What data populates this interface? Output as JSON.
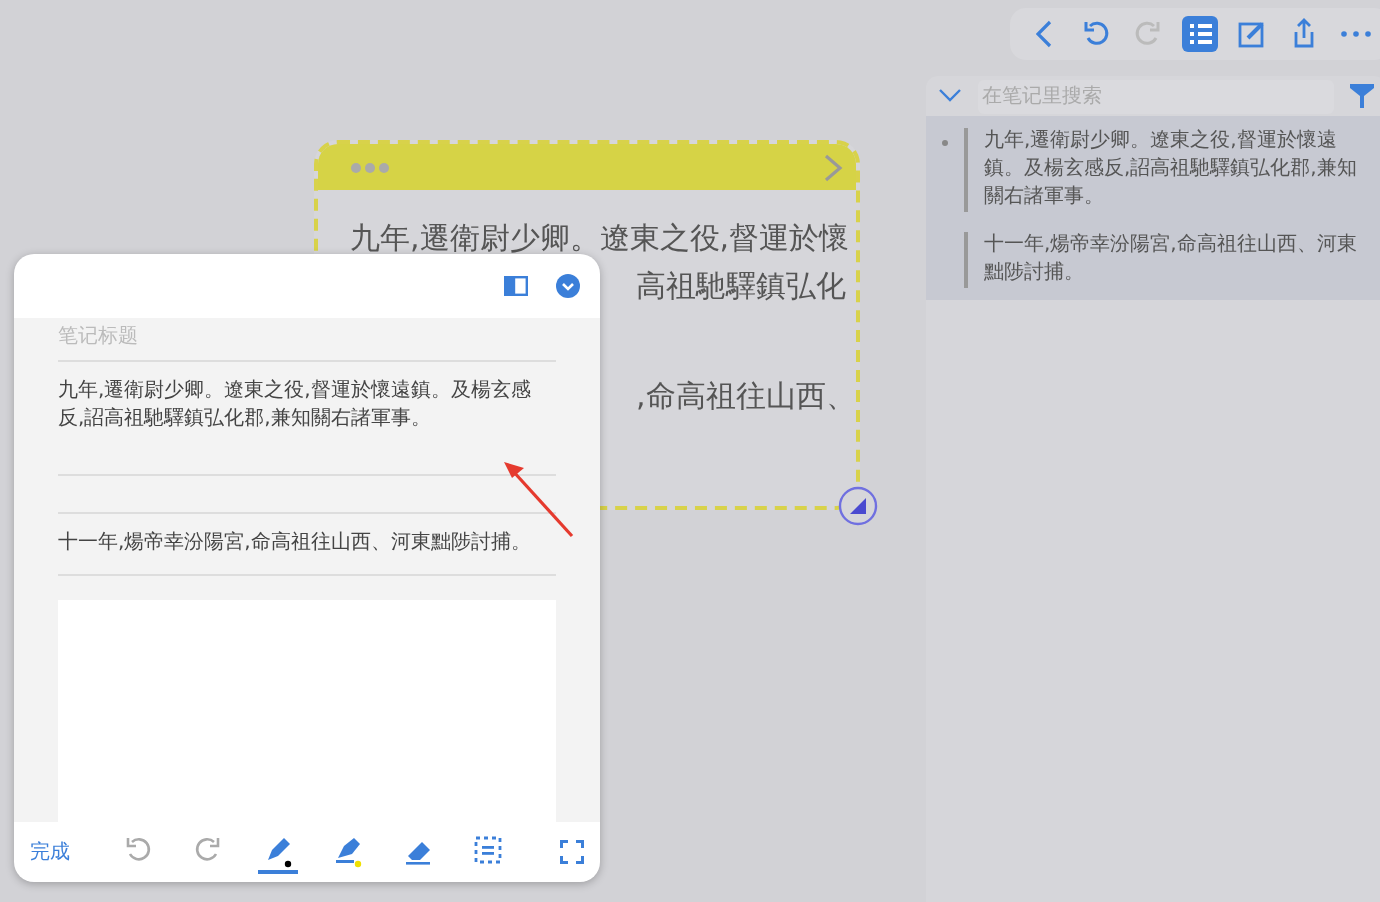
{
  "toolbar": [
    {
      "kind": "back",
      "selected": false,
      "disabled": false
    },
    {
      "kind": "undo",
      "selected": false,
      "disabled": false
    },
    {
      "kind": "redo",
      "selected": false,
      "disabled": true
    },
    {
      "kind": "list",
      "selected": true,
      "disabled": false
    },
    {
      "kind": "edit",
      "selected": false,
      "disabled": false
    },
    {
      "kind": "share",
      "selected": false,
      "disabled": false
    },
    {
      "kind": "more",
      "selected": false,
      "disabled": false
    }
  ],
  "sidebar": {
    "search": {
      "placeholder": "在笔记里搜索"
    },
    "notes": [
      {
        "text": "九年,遷衛尉少卿。遼東之役,督運於懷遠鎮。及楊玄感反,詔高祖馳驛鎮弘化郡,兼知關右諸軍事。",
        "bullet": true
      },
      {
        "text": "十一年,煬帝幸汾陽宮,命高祖往山西、河東黜陟討捕。",
        "bullet": false
      }
    ]
  },
  "card": {
    "lines": [
      "九年,遷衛尉少卿。遼東之役,督運於懷",
      "高祖馳驛鎮弘化",
      ",命高祖往山西、"
    ]
  },
  "editor": {
    "title": {
      "placeholder": "笔记标题"
    },
    "paragraphs": [
      "九年,遷衛尉少卿。遼東之役,督運於懷遠鎮。及楊玄感反,詔高祖馳驛鎮弘化郡,兼知關右諸軍事。",
      "十一年,煬帝幸汾陽宮,命高祖往山西、河東黜陟討捕。"
    ],
    "done": "完成",
    "tools": [
      {
        "kind": "undo",
        "selected": false
      },
      {
        "kind": "redo",
        "selected": false
      },
      {
        "kind": "pen",
        "selected": true
      },
      {
        "kind": "highlighter",
        "selected": false
      },
      {
        "kind": "eraser",
        "selected": false
      },
      {
        "kind": "select",
        "selected": false
      }
    ]
  }
}
